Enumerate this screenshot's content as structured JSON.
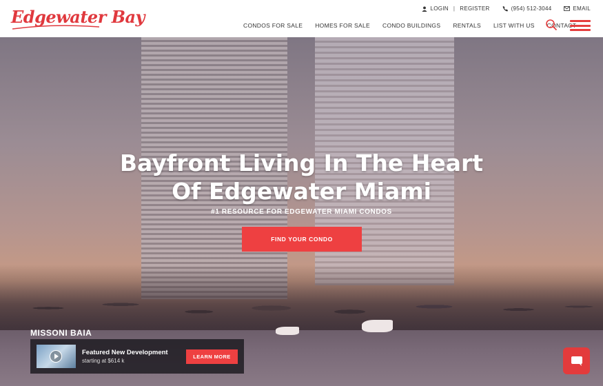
{
  "brand": {
    "logo_text": "Edgewater Bay",
    "accent": "#ee4041"
  },
  "topbar": {
    "login": "LOGIN",
    "separator": "|",
    "register": "REGISTER",
    "phone": "(954) 512-3044",
    "email": "EMAIL"
  },
  "nav": {
    "items": [
      "CONDOS FOR SALE",
      "HOMES FOR SALE",
      "CONDO BUILDINGS",
      "RENTALS",
      "LIST WITH US",
      "CONTACT"
    ]
  },
  "hero": {
    "title_line1": "Bayfront Living In The Heart",
    "title_line2": "Of Edgewater Miami",
    "subtitle": "#1 RESOURCE FOR EDGEWATER MIAMI CONDOS",
    "cta": "FIND YOUR CONDO"
  },
  "featured": {
    "building_name": "MISSONI BAIA",
    "title": "Featured New Development",
    "price": "starting at $614 k",
    "button": "LEARN MORE"
  },
  "icons": {
    "user": "user-icon",
    "phone": "phone-icon",
    "email": "envelope-icon",
    "search": "search-icon",
    "menu": "hamburger-menu-icon",
    "play": "play-icon",
    "chat": "chat-icon"
  }
}
